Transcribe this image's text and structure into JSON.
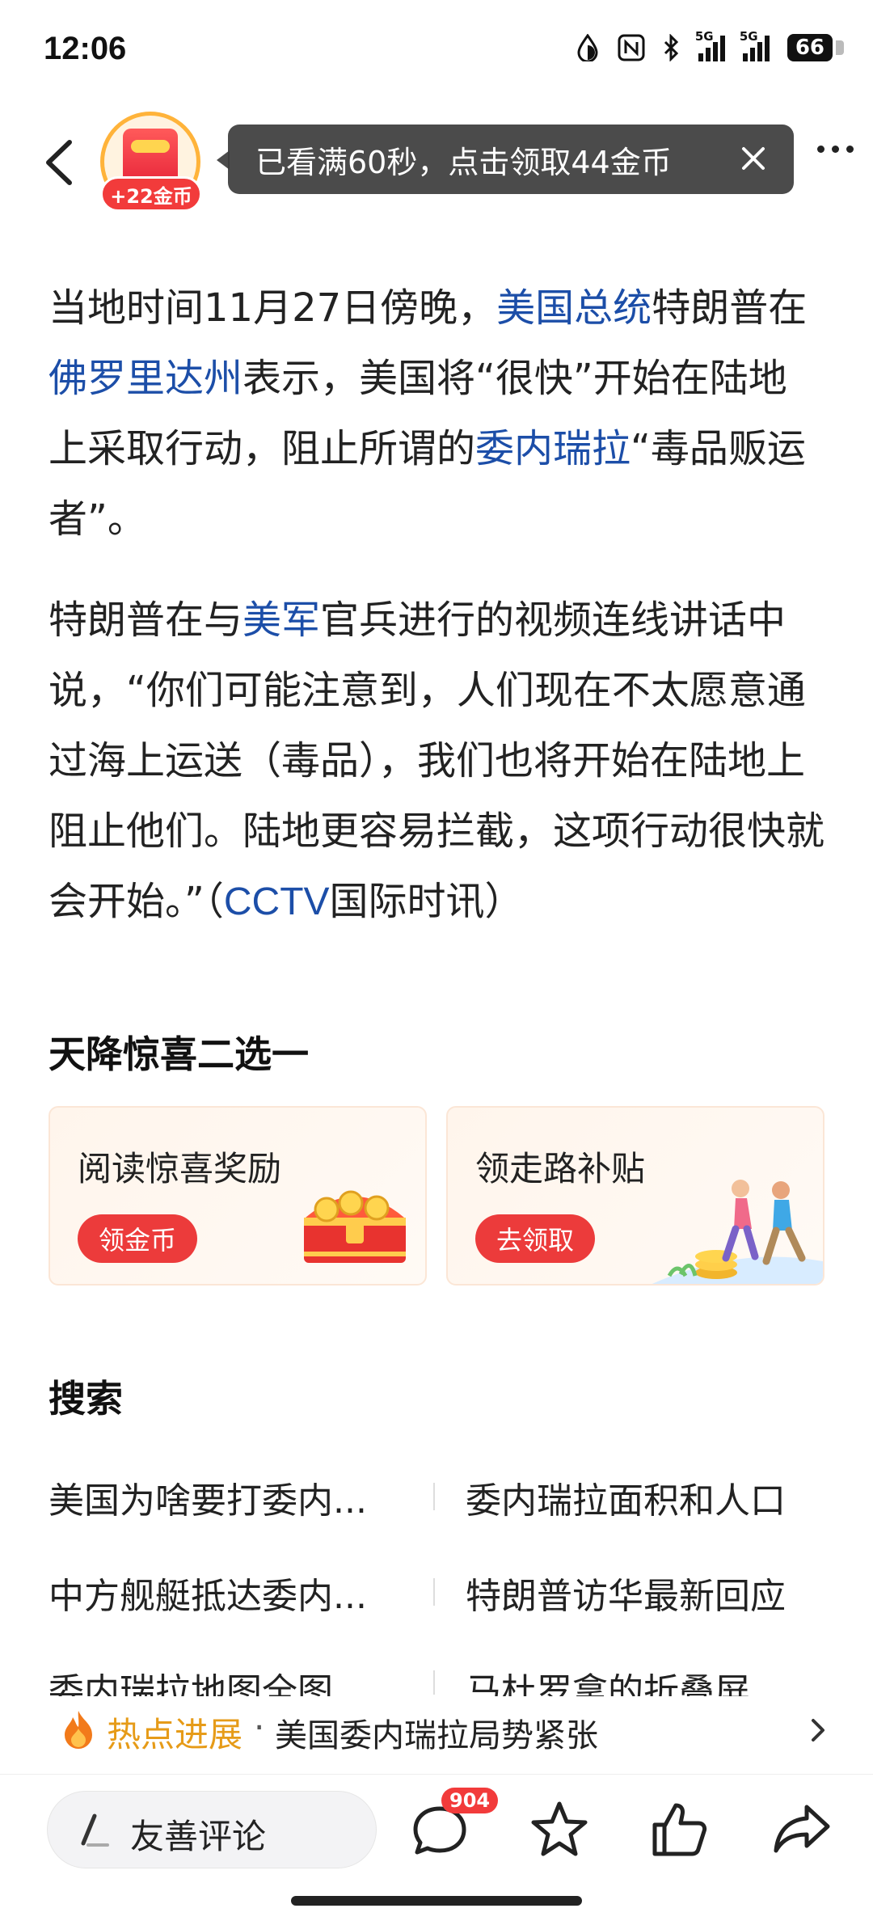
{
  "status_bar": {
    "time": "12:06",
    "network_1": "5G",
    "network_2": "5G",
    "battery": "66"
  },
  "header": {
    "coin_label": "+22金币",
    "toast_text": "已看满60秒，点击领取44金币"
  },
  "article": {
    "p1": {
      "t1": "当地时间11月27日傍晚，",
      "l1": "美国总统",
      "t2": "特朗普在",
      "l2": "佛罗里达州",
      "t3": "表示，美国将“很快”开始在陆地上采取行动，阻止所谓的",
      "l3": "委内瑞拉",
      "t4": "“毒品贩运者”。"
    },
    "p2": {
      "t1": "特朗普在与",
      "l1": "美军",
      "t2": "官兵进行的视频连线讲话中说，“你们可能注意到，人们现在不太愿意通过海上运送（毒品），我们也将开始在陆地上阻止他们。陆地更容易拦截，这项行动很快就会开始。”（",
      "l2": "CCTV",
      "t3": "国际时讯）"
    }
  },
  "surprise": {
    "title": "天降惊喜二选一",
    "cards": [
      {
        "title": "阅读惊喜奖励",
        "button": "领金币"
      },
      {
        "title": "领走路补贴",
        "button": "去领取"
      }
    ]
  },
  "search": {
    "title": "搜索",
    "items": [
      "美国为啥要打委内...",
      "委内瑞拉面积和人口",
      "中方舰艇抵达委内...",
      "特朗普访华最新回应",
      "委内瑞拉地图全图",
      "马杜罗拿的折叠屏"
    ]
  },
  "hot": {
    "label": "热点进展",
    "separator": "·",
    "text": "美国委内瑞拉局势紧张"
  },
  "bottom_bar": {
    "comment_placeholder": "友善评论",
    "comment_count": "904"
  },
  "colors": {
    "link": "#1c4ea8",
    "accent_red": "#ec3b3b",
    "hot_orange": "#e69b18"
  }
}
